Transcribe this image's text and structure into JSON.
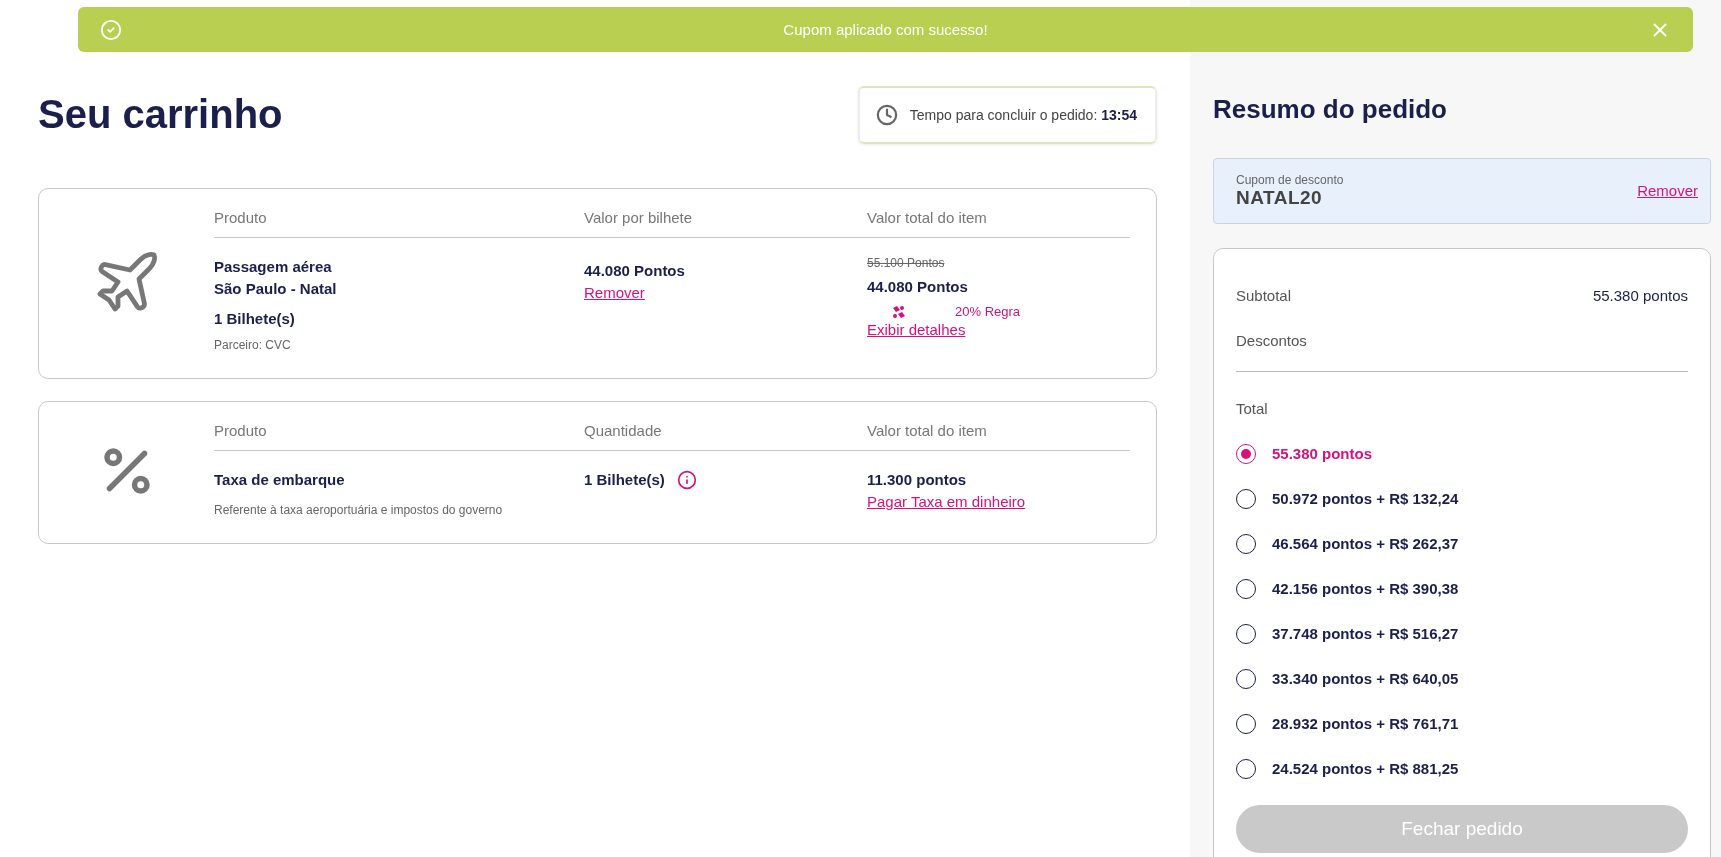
{
  "banner": {
    "message": "Cupom aplicado com sucesso!"
  },
  "cart": {
    "title": "Seu carrinho",
    "timer": {
      "label": "Tempo para concluir o pedido:",
      "value": "13:54"
    },
    "items": [
      {
        "kind": "flight",
        "columns": [
          "Produto",
          "Valor por bilhete",
          "Valor total do item"
        ],
        "name_lines": [
          "Passagem aérea",
          "São Paulo - Natal"
        ],
        "quantity": "1 Bilhete(s)",
        "partner": "Parceiro: CVC",
        "unit_value": "44.080 Pontos",
        "unit_link": "Remover",
        "original_total": "55.100 Pontos",
        "total": "44.080 Pontos",
        "discount": "20% Regra",
        "total_link": "Exibir detalhes"
      },
      {
        "kind": "fee",
        "columns": [
          "Produto",
          "Quantidade",
          "Valor total do item"
        ],
        "name": "Taxa de embarque",
        "description": "Referente à taxa aeroportuária e impostos do governo",
        "quantity": "1 Bilhete(s)",
        "total": "11.300 pontos",
        "total_link": "Pagar Taxa em dinheiro"
      }
    ]
  },
  "summary": {
    "title": "Resumo do pedido",
    "coupon": {
      "label": "Cupom de desconto",
      "code": "NATAL20",
      "action": "Remover"
    },
    "subtotal": {
      "label": "Subtotal",
      "value": "55.380 pontos"
    },
    "discounts": {
      "label": "Descontos"
    },
    "total": {
      "label": "Total"
    },
    "options": [
      {
        "label": "55.380 pontos",
        "selected": true
      },
      {
        "label": "50.972 pontos + R$ 132,24",
        "selected": false
      },
      {
        "label": "46.564 pontos + R$ 262,37",
        "selected": false
      },
      {
        "label": "42.156 pontos + R$ 390,38",
        "selected": false
      },
      {
        "label": "37.748 pontos + R$ 516,27",
        "selected": false
      },
      {
        "label": "33.340 pontos + R$ 640,05",
        "selected": false
      },
      {
        "label": "28.932 pontos + R$ 761,71",
        "selected": false
      },
      {
        "label": "24.524 pontos + R$ 881,25",
        "selected": false
      }
    ],
    "button": {
      "label": "Fechar pedido",
      "disabled": true
    }
  }
}
